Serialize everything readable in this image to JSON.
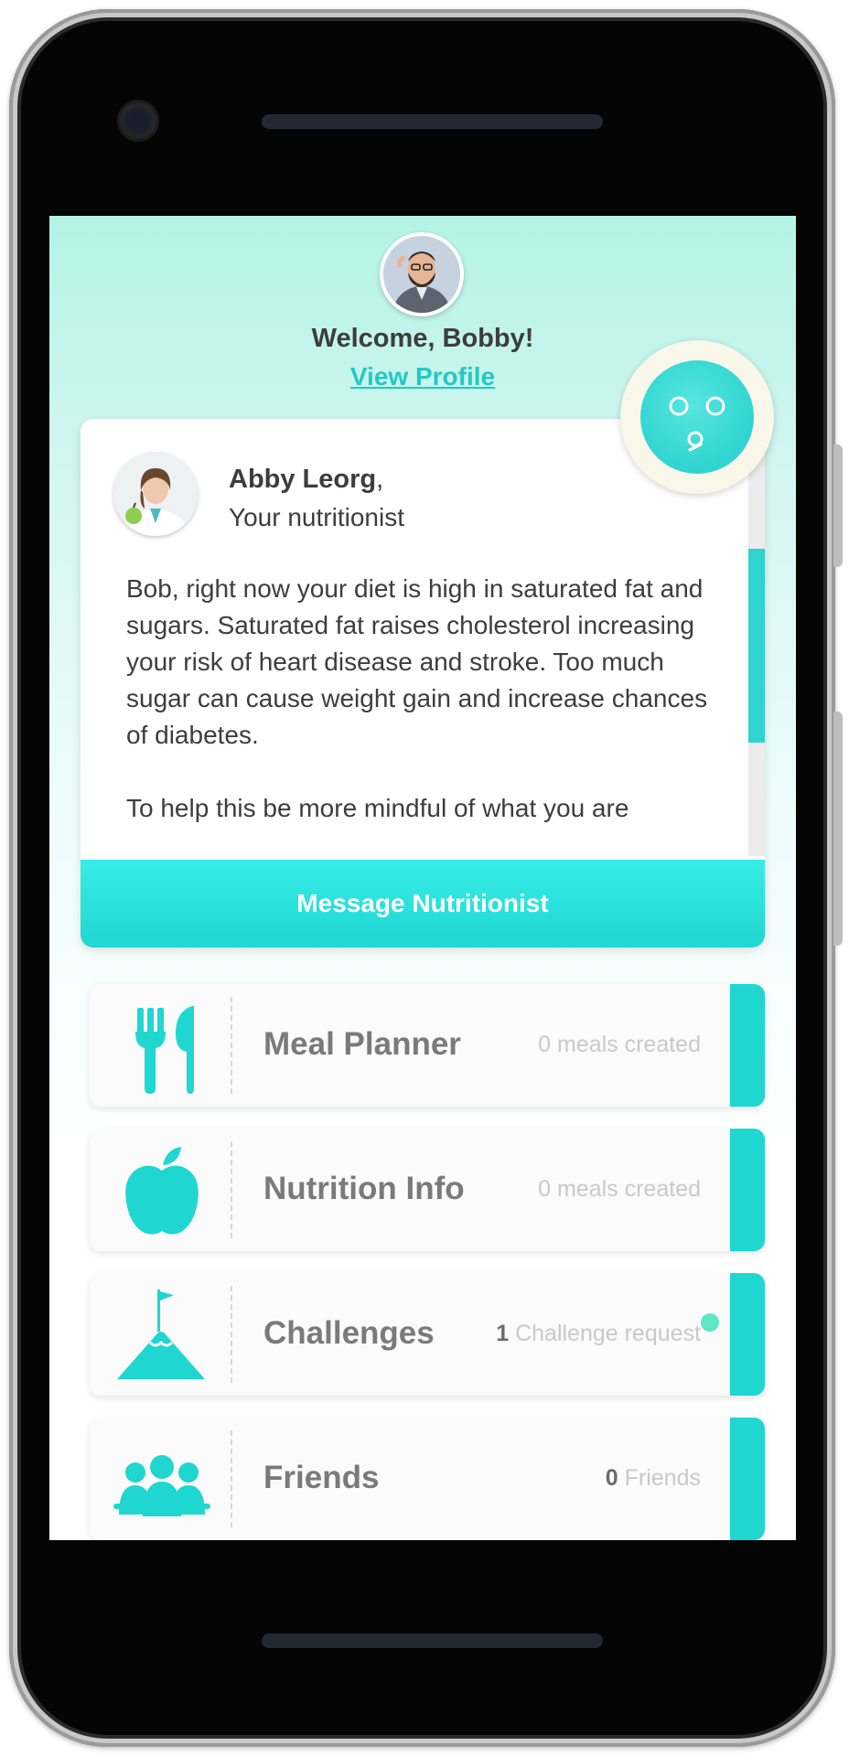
{
  "header": {
    "welcome": "Welcome, Bobby!",
    "view_profile": "View Profile"
  },
  "nutritionist": {
    "name": "Abby Leorg",
    "name_suffix": ",",
    "role": "Your nutritionist",
    "message_paragraphs": [
      "Bob, right now your diet is high in saturated fat and sugars. Saturated fat raises cholesterol increasing your risk of heart disease and stroke. Too much sugar can cause weight gain and increase chances of diabetes.",
      "To help this be more mindful of what you are"
    ],
    "button_label": "Message Nutritionist"
  },
  "menu": [
    {
      "label": "Meal Planner",
      "count": "",
      "meta": "0 meals created",
      "icon": "fork-knife-icon"
    },
    {
      "label": "Nutrition Info",
      "count": "",
      "meta": "0 meals created",
      "icon": "apple-icon"
    },
    {
      "label": "Challenges",
      "count": "1",
      "meta": "Challenge request",
      "icon": "mountain-flag-icon",
      "has_notification": true
    },
    {
      "label": "Friends",
      "count": "0",
      "meta": "Friends",
      "icon": "group-icon"
    }
  ],
  "colors": {
    "accent": "#1fd6d0",
    "text_dark": "#3d3d3d",
    "text_muted": "#c9c9c9",
    "notification": "#5ee6c6"
  }
}
